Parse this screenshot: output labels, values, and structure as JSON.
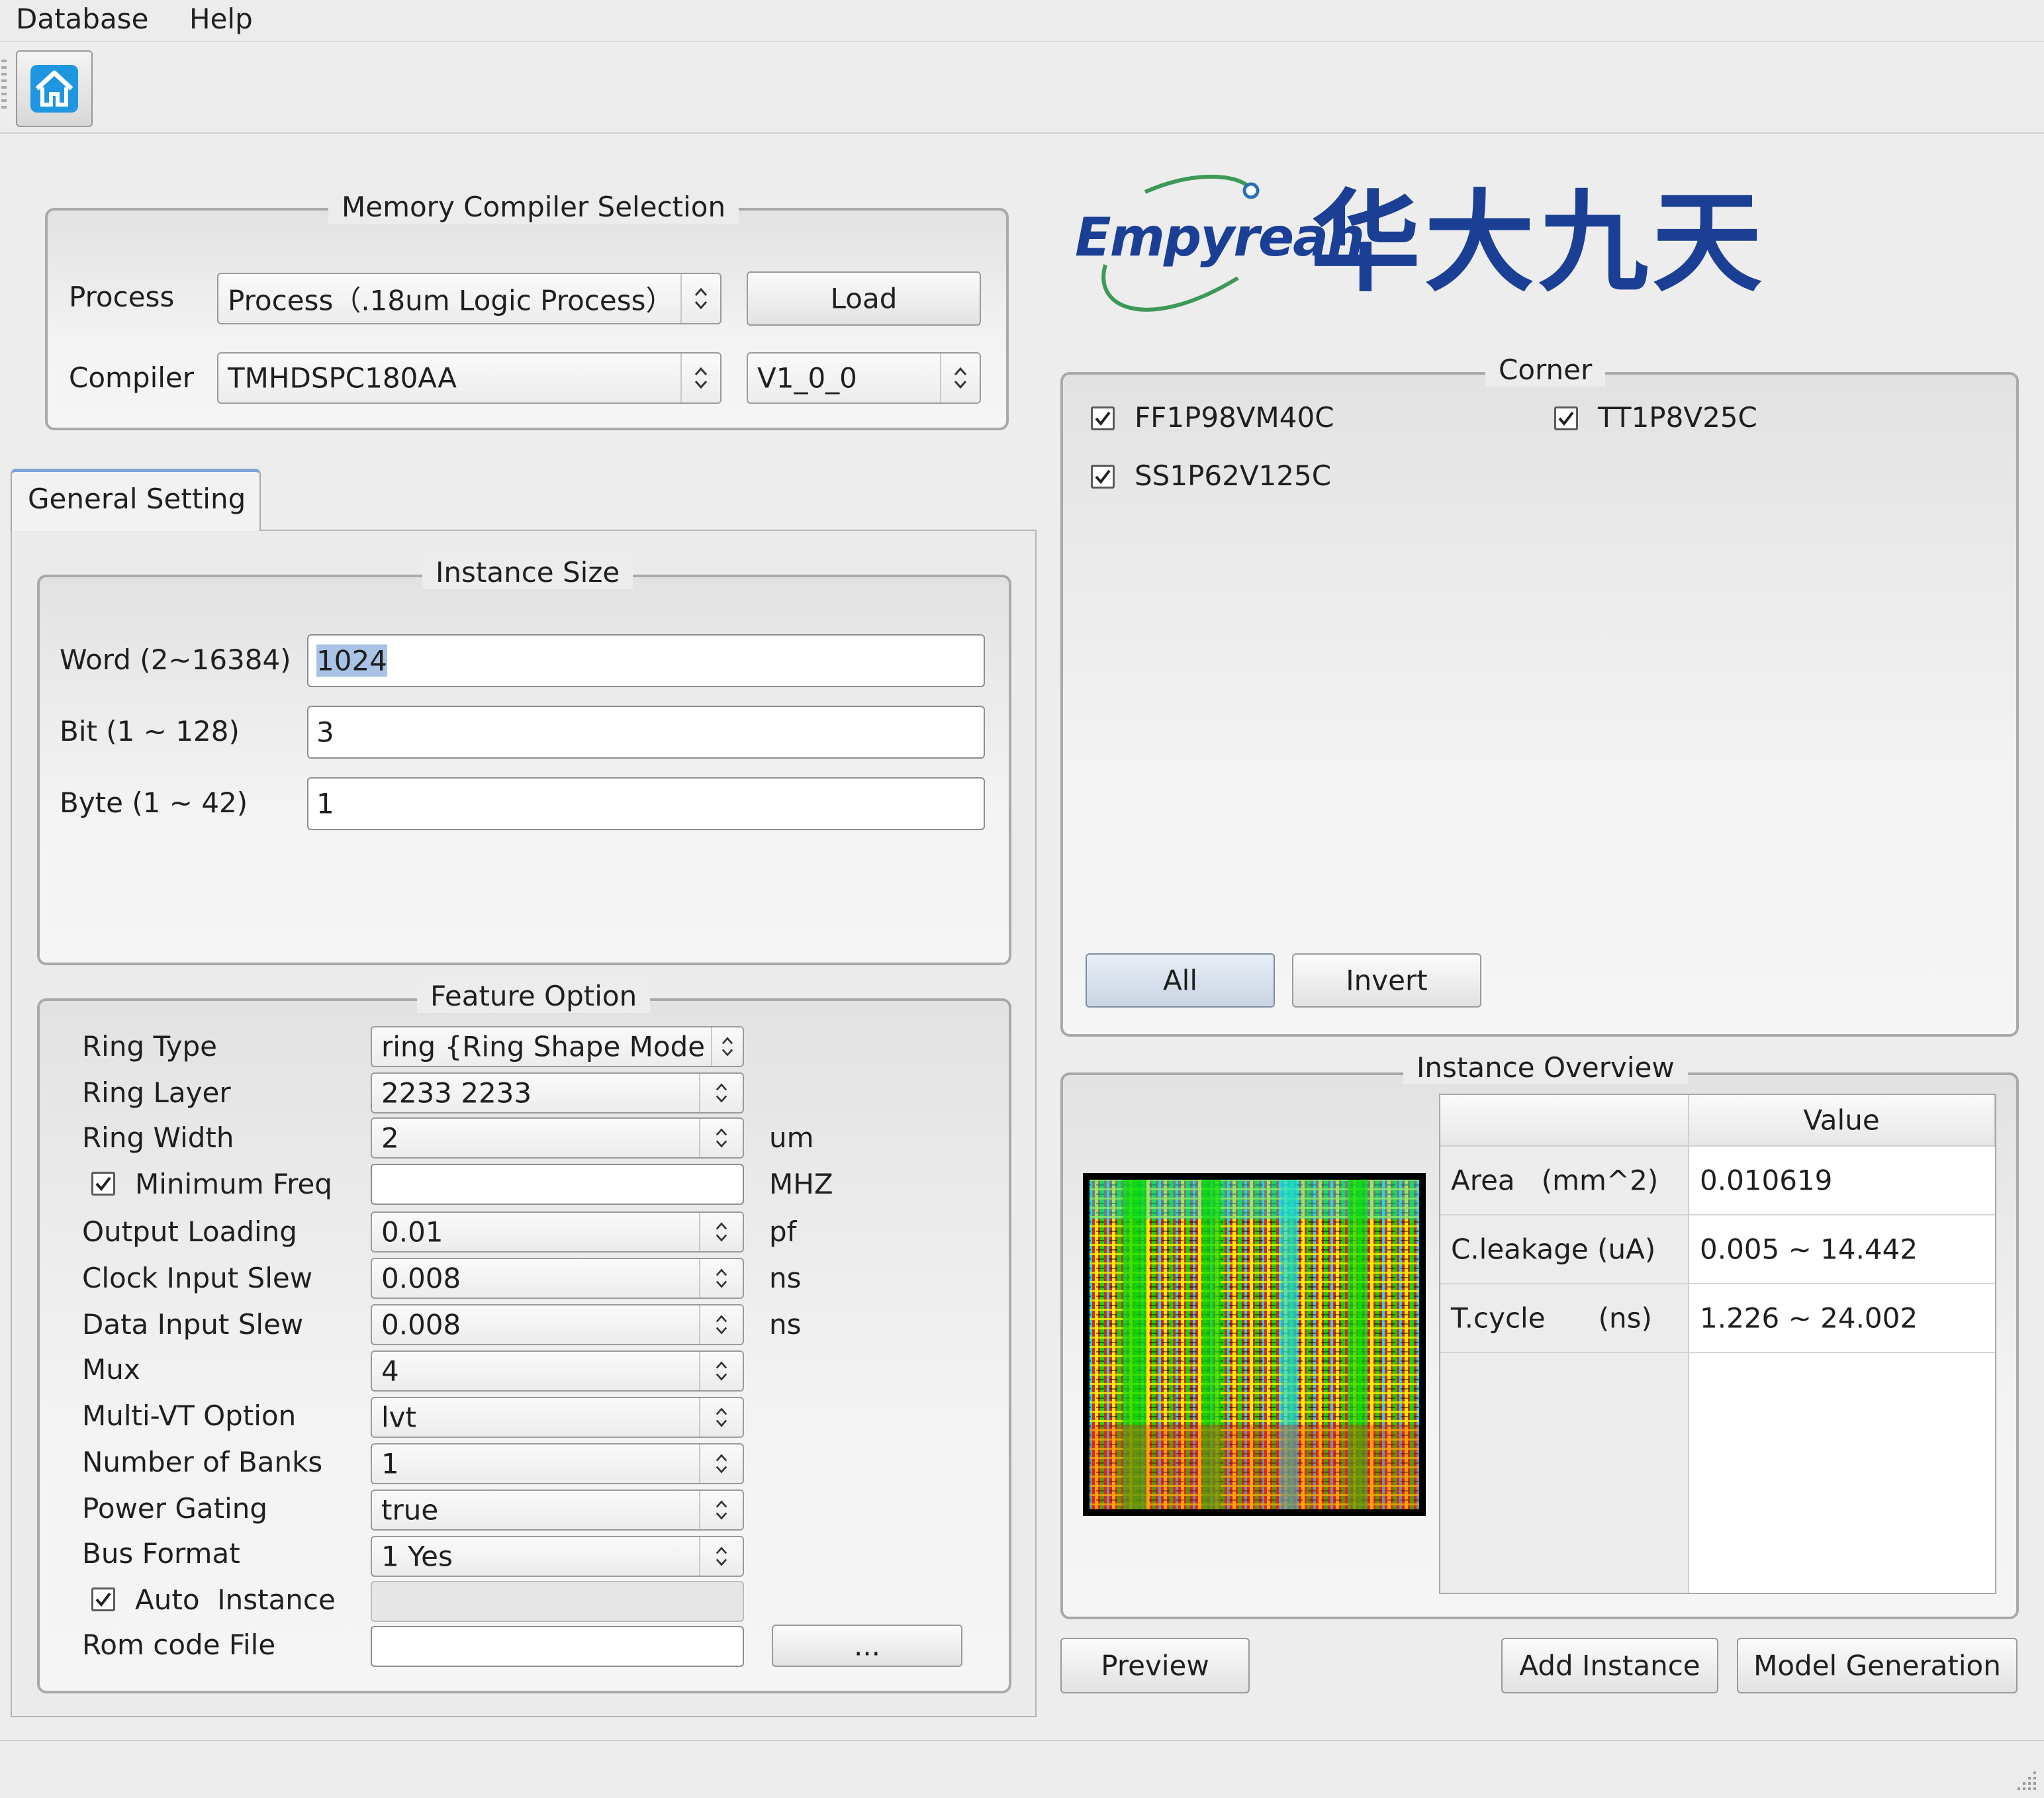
{
  "menu": [
    "Database",
    "Help"
  ],
  "mcs": {
    "title": "Memory Compiler Selection",
    "process_label": "Process",
    "process_value": "Process（.18um Logic Process）",
    "load_label": "Load",
    "compiler_label": "Compiler",
    "compiler_value": "TMHDSPC180AA",
    "version_value": "V1_0_0"
  },
  "logo": {
    "latin": "Empyrean",
    "chinese": "华大九天",
    "colors": {
      "blue": "#1a3f95",
      "green": "#3d9a56"
    }
  },
  "tabs": [
    "General Setting"
  ],
  "instance_size": {
    "title": "Instance Size",
    "fields": [
      {
        "label": "Word (2~16384)",
        "value": "1024"
      },
      {
        "label": "Bit (1 ~ 128)",
        "value": "3"
      },
      {
        "label": "Byte (1 ~ 42)",
        "value": "1"
      }
    ]
  },
  "feature": {
    "title": "Feature Option",
    "rows": [
      {
        "label": "Ring Type",
        "value": "ring {Ring Shape Mode",
        "unit": ""
      },
      {
        "label": "Ring Layer",
        "value": "2233 2233",
        "unit": ""
      },
      {
        "label": "Ring Width",
        "value": "2",
        "unit": "um"
      },
      {
        "label": "Minimum Freq",
        "value": "",
        "unit": "MHZ"
      },
      {
        "label": "Output Loading",
        "value": "0.01",
        "unit": "pf"
      },
      {
        "label": "Clock Input Slew",
        "value": "0.008",
        "unit": "ns"
      },
      {
        "label": "Data Input Slew",
        "value": "0.008",
        "unit": "ns"
      },
      {
        "label": "Mux",
        "value": "4",
        "unit": ""
      },
      {
        "label": "Multi-VT Option",
        "value": "lvt",
        "unit": ""
      },
      {
        "label": "Number of Banks",
        "value": "1",
        "unit": ""
      },
      {
        "label": "Power Gating",
        "value": "true",
        "unit": ""
      },
      {
        "label": "Bus Format",
        "value": "1 Yes",
        "unit": ""
      },
      {
        "label": "Auto  Instance",
        "value": "",
        "unit": ""
      },
      {
        "label": "Rom code File",
        "value": "",
        "unit": ""
      }
    ],
    "browse_label": "..."
  },
  "corner": {
    "title": "Corner",
    "items": [
      {
        "label": "FF1P98VM40C",
        "checked": true
      },
      {
        "label": "TT1P8V25C",
        "checked": true
      },
      {
        "label": "SS1P62V125C",
        "checked": true
      }
    ],
    "all_label": "All",
    "invert_label": "Invert"
  },
  "overview": {
    "title": "Instance Overview",
    "header": [
      "",
      "Value"
    ],
    "rows": [
      {
        "name": "Area   (mm^2)",
        "value": "0.010619"
      },
      {
        "name": "C.leakage (uA)",
        "value": "0.005 ~ 14.442"
      },
      {
        "name": "T.cycle      (ns)",
        "value": "1.226 ~ 24.002"
      }
    ]
  },
  "actions": {
    "preview": "Preview",
    "add_instance": "Add Instance",
    "model_generation": "Model Generation"
  }
}
